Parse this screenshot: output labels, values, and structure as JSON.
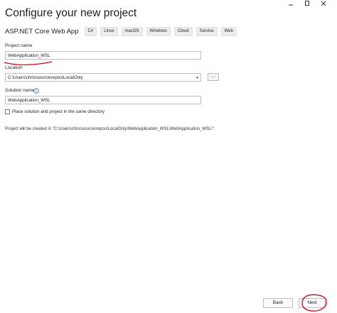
{
  "window": {
    "controls": [
      "minimize-icon",
      "maximize-icon",
      "close-icon"
    ]
  },
  "page_title": "Configure your new project",
  "template": {
    "name": "ASP.NET Core Web App",
    "tags": [
      "C#",
      "Linux",
      "macOS",
      "Windows",
      "Cloud",
      "Service",
      "Web"
    ]
  },
  "project_name": {
    "label": "Project name",
    "value": "WebApplication_WSL"
  },
  "location": {
    "label": "Location",
    "value": "C:\\Users\\chris\\source\\repos\\LocalOnly",
    "browse_label": "..."
  },
  "solution_name": {
    "label": "Solution name",
    "value": "WebApplication_WSL"
  },
  "same_directory": {
    "label": "Place solution and project in the same directory",
    "checked": false
  },
  "path_info": "Project will be created in \"C:\\Users\\chris\\source\\repos\\LocalOnly\\WebApplication_WSL\\WebApplication_WSL\\\"",
  "buttons": {
    "back": "Back",
    "next": "Next"
  },
  "colors": {
    "annotation_red": "#d0021b",
    "info_blue": "#1a73c7"
  }
}
